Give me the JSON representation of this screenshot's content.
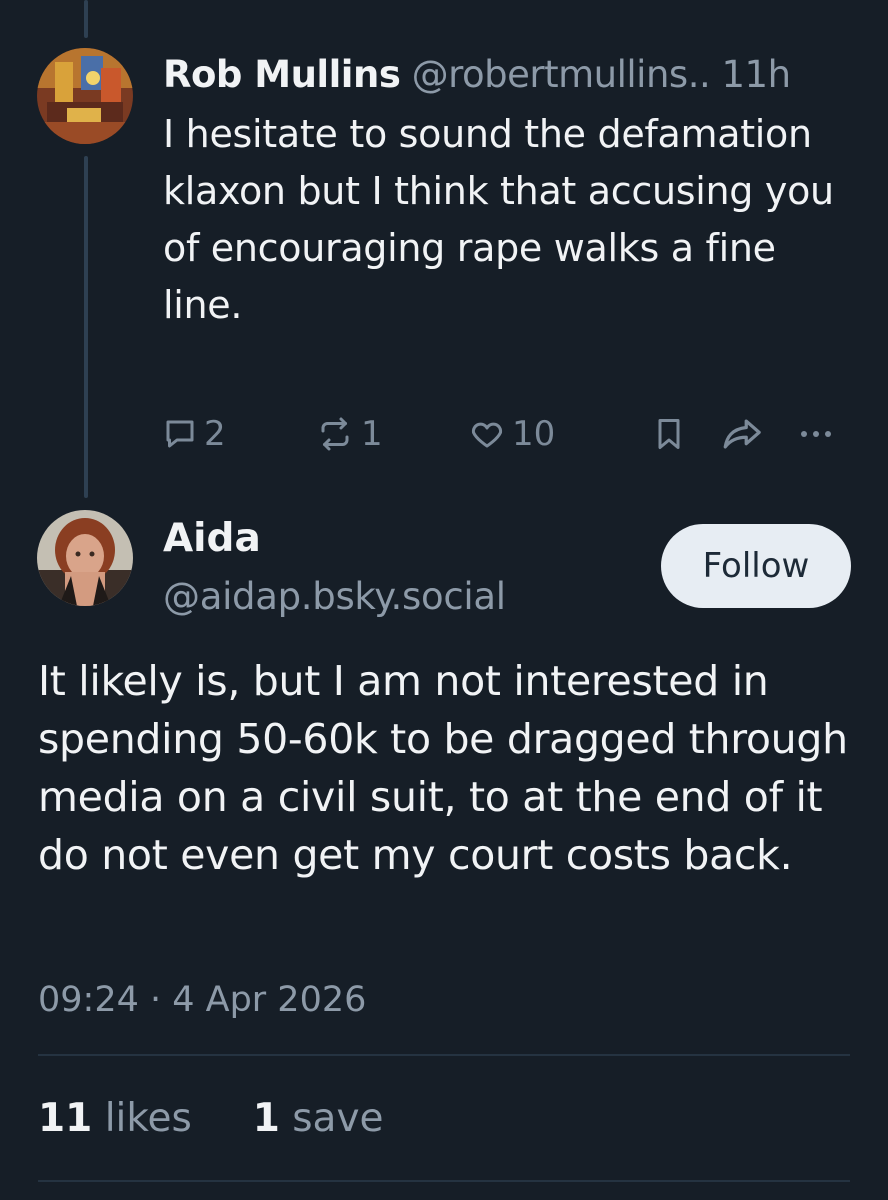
{
  "parent_post": {
    "author_name": "Rob Mullins",
    "author_handle": "@robertmullins..",
    "time": "11h",
    "text": "I hesitate to sound the defamation klaxon but I think that accusing you of encouraging rape walks a fine line.",
    "actions": {
      "replies": "2",
      "reposts": "1",
      "likes": "10"
    }
  },
  "reply_post": {
    "author_name": "Aida",
    "author_handle": "@aidap.bsky.social",
    "follow_label": "Follow",
    "text": "It likely is, but I am not interested in spending 50-60k to be dragged through media on a civil suit, to at the end of it do not even get my court costs back.",
    "timestamp": "09:24 · 4 Apr 2026",
    "stats": {
      "likes_count": "11",
      "likes_label": "likes",
      "saves_count": "1",
      "saves_label": "save"
    }
  },
  "icons": {
    "reply": "reply-icon",
    "repost": "repost-icon",
    "like": "heart-icon",
    "bookmark": "bookmark-icon",
    "share": "share-icon",
    "more": "more-icon"
  },
  "colors": {
    "background": "#161e27",
    "text_primary": "#f1f3f5",
    "text_secondary": "#8d9aa8",
    "icon_muted": "#7c8a99",
    "thread_line": "#2e4052",
    "follow_button_bg": "#e7edf3"
  }
}
